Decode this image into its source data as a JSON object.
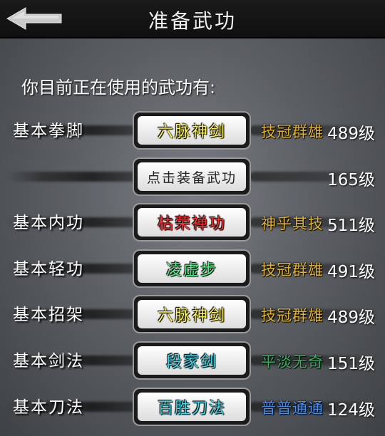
{
  "header": {
    "title": "准备武功"
  },
  "subtitle": "你目前正在使用的武功有:",
  "slots": [
    {
      "label": "基本拳脚",
      "skill": "六脉神剑",
      "skill_color": "#fff45a",
      "rank": "技冠群雄",
      "rank_color": "#e0b130",
      "level": "489级"
    },
    {
      "label": "",
      "skill": "点击装备武功",
      "skill_color": "#222222",
      "rank": "",
      "rank_color": "#e0b130",
      "level": "165级"
    },
    {
      "label": "基本内功",
      "skill": "枯荣禅功",
      "skill_color": "#ff3030",
      "rank": "神乎其技",
      "rank_color": "#e0b130",
      "level": "511级"
    },
    {
      "label": "基本轻功",
      "skill": "凌虚步",
      "skill_color": "#59f08a",
      "rank": "技冠群雄",
      "rank_color": "#e0b130",
      "level": "491级"
    },
    {
      "label": "基本招架",
      "skill": "六脉神剑",
      "skill_color": "#fff45a",
      "rank": "技冠群雄",
      "rank_color": "#e0b130",
      "level": "489级"
    },
    {
      "label": "基本剑法",
      "skill": "段家剑",
      "skill_color": "#3ed8e8",
      "rank": "平淡无奇",
      "rank_color": "#3fa860",
      "level": "151级"
    },
    {
      "label": "基本刀法",
      "skill": "百胜刀法",
      "skill_color": "#3ed8e8",
      "rank": "普普通通",
      "rank_color": "#4a8ff0",
      "level": "124级"
    }
  ]
}
